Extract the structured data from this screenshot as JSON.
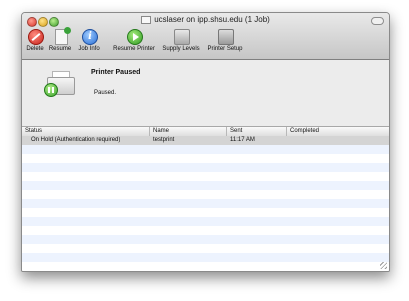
{
  "window": {
    "title": "ucslaser on ipp.shsu.edu (1 Job)"
  },
  "toolbar": {
    "delete": "Delete",
    "resume": "Resume",
    "job_info": "Job Info",
    "resume_printer": "Resume Printer",
    "supply_levels": "Supply Levels",
    "printer_setup": "Printer Setup"
  },
  "status": {
    "heading": "Printer Paused",
    "detail": "Paused."
  },
  "table": {
    "columns": [
      "Status",
      "Name",
      "Sent",
      "Completed"
    ],
    "rows": [
      {
        "status": "On Hold (Authentication required)",
        "name": "testprint",
        "sent": "11:17 AM",
        "completed": ""
      }
    ]
  },
  "colors": {
    "selected_row": "#d4d4d4",
    "stripe": "#edf3fe",
    "pause_green": "#37a02a"
  }
}
